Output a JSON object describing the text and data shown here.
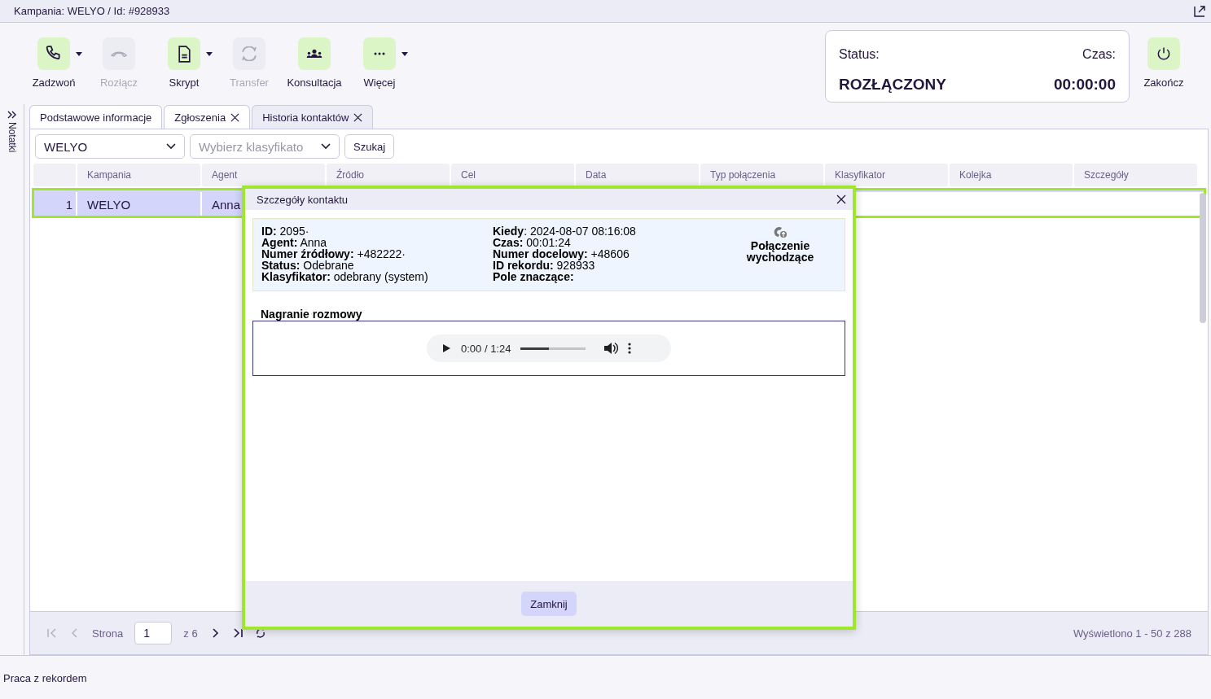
{
  "header": {
    "title": "Kampania: WELYO / Id: #928933"
  },
  "toolbar": [
    {
      "label": "Zadzwoń",
      "kind": "phone",
      "disabled": false,
      "dropdown": true
    },
    {
      "label": "Rozłącz",
      "kind": "hangup",
      "disabled": true,
      "dropdown": false
    },
    {
      "label": "Skrypt",
      "kind": "document",
      "disabled": false,
      "dropdown": true
    },
    {
      "label": "Transfer",
      "kind": "transfer",
      "disabled": true,
      "dropdown": false
    },
    {
      "label": "Konsultacja",
      "kind": "people",
      "disabled": false,
      "dropdown": false
    },
    {
      "label": "Więcej",
      "kind": "more",
      "disabled": false,
      "dropdown": true
    }
  ],
  "status_panel": {
    "status_label": "Status:",
    "status": "ROZŁĄCZONY",
    "time_label": "Czas:",
    "time": "00:00:00"
  },
  "end_button": {
    "label": "Zakończ"
  },
  "side_panel": {
    "label": "Notatki"
  },
  "tabs": [
    {
      "label": "Podstawowe informacje",
      "selected": false,
      "closable": false
    },
    {
      "label": "Zgłoszenia",
      "selected": false,
      "closable": true
    },
    {
      "label": "Historia kontaktów",
      "selected": true,
      "closable": true
    }
  ],
  "filters": {
    "campaign": "WELYO",
    "classifier_placeholder": "Wybierz klasyfikato",
    "search_button": "Szukaj"
  },
  "table": {
    "columns": [
      "Kampania",
      "Agent",
      "Źródło",
      "Cel",
      "Data",
      "Typ połączenia",
      "Klasyfikator",
      "Kolejka",
      "Szczegóły"
    ],
    "rows": [
      {
        "number": "1",
        "cells": [
          "WELYO",
          "Anna"
        ],
        "selected": true
      }
    ]
  },
  "pagination": {
    "page_label": "Strona",
    "page": "1",
    "of": "z 6",
    "summary": "Wyświetlono 1 - 50 z 288"
  },
  "status_bar": {
    "text": "Praca z rekordem"
  },
  "dialog": {
    "title": "Szczegóły kontaktu",
    "details_left": [
      "**ID:** 2095·",
      "**Agent:** Anna",
      "**Numer źródłowy:** +482222·",
      "**Status:** Odebrane",
      "**Klasyfikator:** odebrany (system)"
    ],
    "details_right": [
      "**Kiedy**: 2024-08-07 08:16:08",
      "**Czas:** 00:01:24",
      "**Numer docelowy:** +48606",
      "**ID rekordu:** 928933",
      "**Pole znaczące:**"
    ],
    "call_type": "Połączenie wychodzące",
    "recording_title": "Nagranie rozmowy",
    "player": {
      "time": "0:00 / 1:24",
      "level": 0.43
    },
    "close_button": "Zamknij"
  }
}
